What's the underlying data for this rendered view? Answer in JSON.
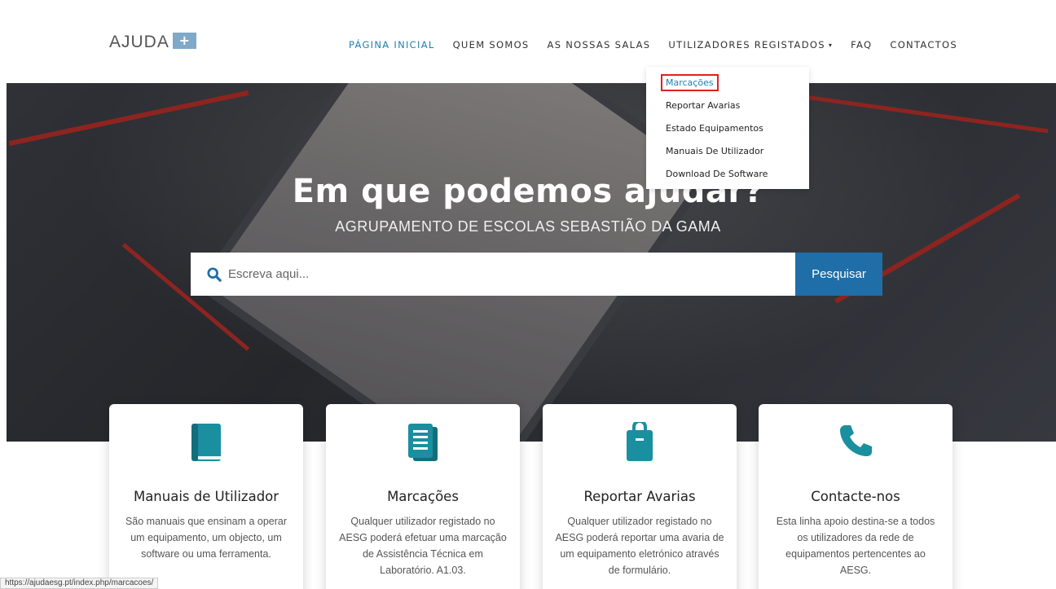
{
  "logo": {
    "text": "AJUDA",
    "plus": "+"
  },
  "nav": {
    "items": [
      {
        "label": "PÁGINA INICIAL"
      },
      {
        "label": "QUEM SOMOS"
      },
      {
        "label": "AS NOSSAS SALAS"
      },
      {
        "label": "UTILIZADORES REGISTADOS"
      },
      {
        "label": "FAQ"
      },
      {
        "label": "CONTACTOS"
      }
    ],
    "active_color": "#1f7fb0"
  },
  "dropdown": {
    "items": [
      {
        "label": "Marcações"
      },
      {
        "label": "Reportar Avarias"
      },
      {
        "label": "Estado Equipamentos"
      },
      {
        "label": "Manuais De Utilizador"
      },
      {
        "label": "Download De Software"
      }
    ]
  },
  "hero": {
    "title": "Em que podemos ajudar?",
    "subtitle": "AGRUPAMENTO DE ESCOLAS SEBASTIÃO DA GAMA"
  },
  "search": {
    "placeholder": "Escreva aqui...",
    "button_label": "Pesquisar",
    "button_color": "#1f6ea8"
  },
  "cards": [
    {
      "title": "Manuais de Utilizador",
      "desc": "São manuais que ensinam a operar um equipamento, um objecto, um software ou uma ferramenta.",
      "icon": "book-icon"
    },
    {
      "title": "Marcações",
      "desc": "Qualquer utilizador registado no AESG poderá efetuar uma marcação de Assistência Técnica em Laboratório. A1.03.",
      "icon": "document-icon"
    },
    {
      "title": "Reportar Avarias",
      "desc": "Qualquer utilizador registado no AESG poderá reportar uma avaria de um equipamento eletrónico através de formulário.",
      "icon": "clipboard-icon"
    },
    {
      "title": "Contacte-nos",
      "desc": "Esta linha apoio destina-se a todos os utilizadores da rede de equipamentos pertencentes ao AESG.",
      "icon": "phone-icon"
    }
  ],
  "icon_color": "#1a8fa0",
  "status_bar": {
    "url": "https://ajudaesg.pt/index.php/marcacoes/"
  }
}
